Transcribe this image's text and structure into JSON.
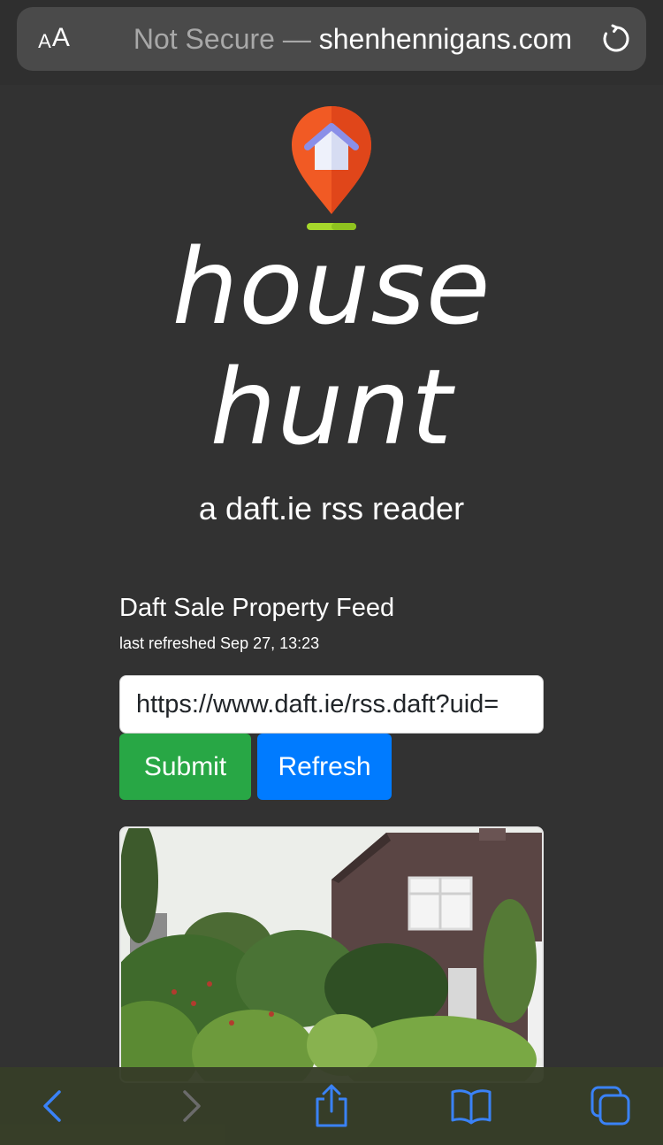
{
  "browser": {
    "text_size_label": "AA",
    "not_secure_label": "Not Secure",
    "separator": "—",
    "domain": "shenhennigans.com"
  },
  "page": {
    "title_line1": "house",
    "title_line2": "hunt",
    "subtitle": "a daft.ie rss reader",
    "feed_title": "Daft Sale Property Feed",
    "last_refreshed": "last refreshed Sep 27, 13:23",
    "feed_url_value": "https://www.daft.ie/rss.daft?uid=",
    "submit_label": "Submit",
    "refresh_label": "Refresh"
  },
  "toolbar": {
    "buttons": [
      "back-icon",
      "forward-icon",
      "share-icon",
      "bookmarks-icon",
      "tabs-icon"
    ]
  },
  "colors": {
    "page_bg": "#323232",
    "submit": "#28a745",
    "refresh": "#007bff",
    "toolbar_icon": "#3a82f7",
    "pin_orange": "#f15a24",
    "pin_underline": "#a6d82b"
  }
}
